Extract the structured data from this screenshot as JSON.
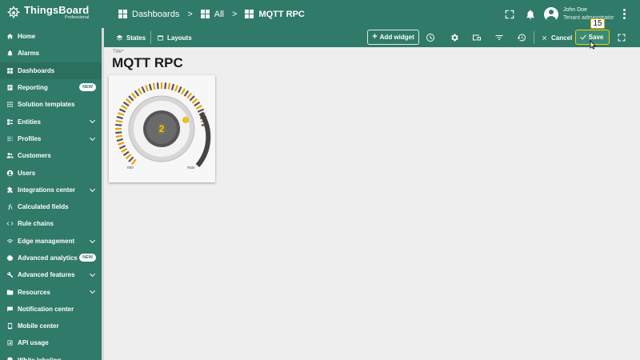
{
  "header": {
    "logo_name": "ThingsBoard",
    "logo_sub": "Professional",
    "breadcrumbs": [
      {
        "label": "Dashboards",
        "icon": "dashboard-icon"
      },
      {
        "label": "All",
        "icon": "dashboard-icon"
      },
      {
        "label": "MQTT RPC",
        "icon": "dashboard-icon"
      }
    ],
    "breadcrumb_separator": ">",
    "user_name": "John Doe",
    "user_role": "Tenant administrator",
    "icons": [
      "fullscreen-icon",
      "notifications-bell-icon",
      "account-avatar-icon",
      "more-vert-icon"
    ]
  },
  "sidebar": {
    "items": [
      {
        "label": "Home",
        "icon": "home-icon"
      },
      {
        "label": "Alarms",
        "icon": "alarm-icon"
      },
      {
        "label": "Dashboards",
        "icon": "dashboard-icon",
        "active": true
      },
      {
        "label": "Reporting",
        "icon": "reporting-icon",
        "badge": "NEW"
      },
      {
        "label": "Solution templates",
        "icon": "apps-icon"
      },
      {
        "label": "Entities",
        "icon": "entities-icon",
        "expandable": true
      },
      {
        "label": "Profiles",
        "icon": "profiles-icon",
        "expandable": true
      },
      {
        "label": "Customers",
        "icon": "customers-icon"
      },
      {
        "label": "Users",
        "icon": "users-icon"
      },
      {
        "label": "Integrations center",
        "icon": "integrations-icon",
        "expandable": true
      },
      {
        "label": "Calculated fields",
        "icon": "function-icon"
      },
      {
        "label": "Rule chains",
        "icon": "code-icon"
      },
      {
        "label": "Edge management",
        "icon": "edge-icon",
        "expandable": true
      },
      {
        "label": "Advanced analytics",
        "icon": "analytics-icon",
        "badge": "NEW"
      },
      {
        "label": "Advanced features",
        "icon": "tools-icon",
        "expandable": true
      },
      {
        "label": "Resources",
        "icon": "folder-icon",
        "expandable": true
      },
      {
        "label": "Notification center",
        "icon": "notification-center-icon"
      },
      {
        "label": "Mobile center",
        "icon": "mobile-icon"
      },
      {
        "label": "API usage",
        "icon": "api-usage-icon"
      },
      {
        "label": "White labeling",
        "icon": "white-labeling-icon"
      }
    ]
  },
  "toolbar": {
    "states_label": "States",
    "layouts_label": "Layouts",
    "add_widget_label": "Add widget",
    "cancel_label": "Cancel",
    "save_label": "Save",
    "step_number": "15",
    "icons": [
      "timewindow-icon",
      "settings-icon",
      "aliases-icon",
      "filters-icon",
      "version-history-icon",
      "fullscreen-icon"
    ]
  },
  "dashboard": {
    "title_label": "Title*",
    "title": "MQTT RPC"
  },
  "widget": {
    "type": "knob-control",
    "value": "2",
    "min_label": "min",
    "max_label": "max",
    "colors": {
      "tick_active": "#f0a000",
      "tick_inactive": "#555555",
      "indicator": "#f5c400"
    }
  },
  "colors": {
    "primary": "#2f7a68",
    "highlight": "#f6d000",
    "background": "#eeeeee"
  }
}
